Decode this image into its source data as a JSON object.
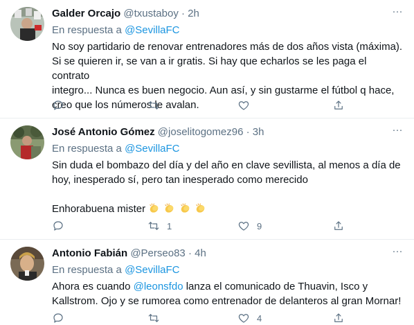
{
  "colors": {
    "link": "#1b95e0",
    "muted": "#5b7083",
    "text": "#0f1419",
    "divider": "#ebeef0"
  },
  "tweets": [
    {
      "name": "Galder Orcajo",
      "handle": "@txustaboy",
      "sep": "·",
      "time": "2h",
      "reply_prefix": "En respuesta a",
      "reply_handle": "@SevillaFC",
      "lines": [
        "No soy partidario de renovar entrenadores más de dos años vista (máxima).",
        "Si se quieren ir, se van a ir gratis. Si hay que echarlos se les paga el contrato",
        "integro... Nunca es buen negocio. Aun así, y sin gustarme el fútbol q hace,",
        "creo que los números le avalan."
      ],
      "actions": {
        "reply": "",
        "retweet": "",
        "like": "",
        "share": ""
      }
    },
    {
      "name": "José Antonio Gómez",
      "handle": "@joselitogomez96",
      "sep": "·",
      "time": "3h",
      "reply_prefix": "En respuesta a",
      "reply_handle": "@SevillaFC",
      "lines": [
        "Sin duda el bombazo del día y del año en clave sevillista, al menos a día de",
        "hoy, inesperado sí, pero tan inesperado como merecido"
      ],
      "extra_line": "Enhorabuena mister",
      "emojis": [
        "clapping-hands",
        "clapping-hands",
        "clapping-hands",
        "clapping-hands"
      ],
      "actions": {
        "reply": "",
        "retweet": "1",
        "like": "9",
        "share": ""
      }
    },
    {
      "name": "Antonio Fabián",
      "handle": "@Perseo83",
      "sep": "·",
      "time": "4h",
      "reply_prefix": "En respuesta a",
      "reply_handle": "@SevillaFC",
      "line1_prefix": "Ahora es cuando",
      "line1_mention": "@leonsfdo",
      "line1_suffix": "lanza el comunicado de Thuavin, Isco y",
      "line2": "Kallstrom. Ojo y se rumorea como entrenador de delanteros al gran Mornar!",
      "actions": {
        "reply": "",
        "retweet": "",
        "like": "4",
        "share": ""
      }
    }
  ]
}
